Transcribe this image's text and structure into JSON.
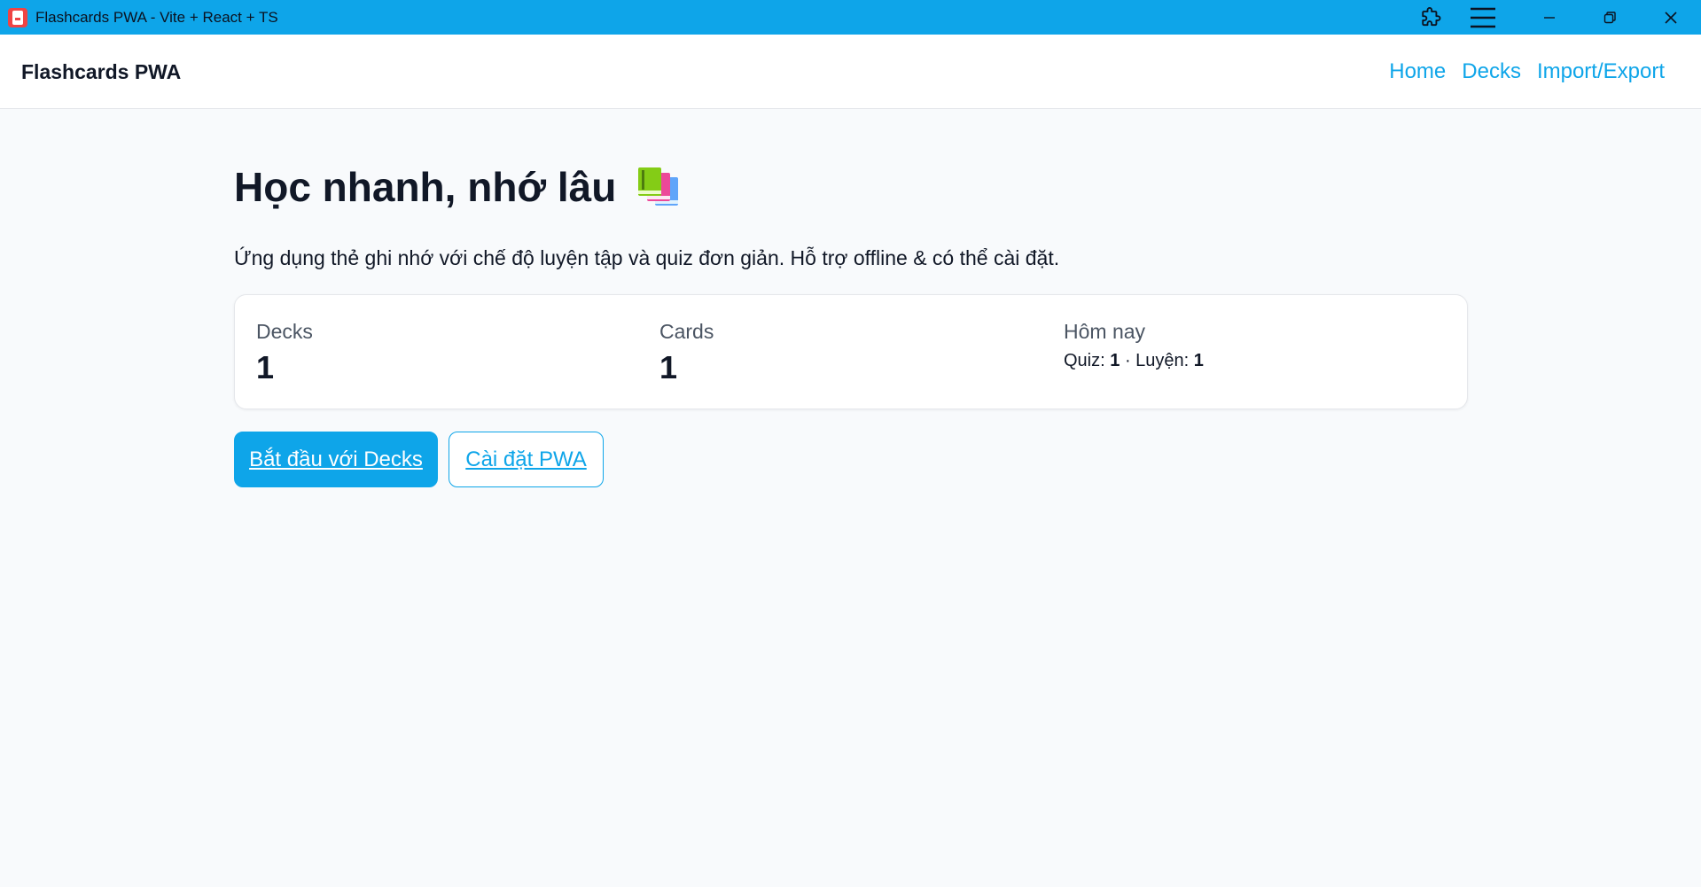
{
  "window": {
    "title": "Flashcards PWA - Vite + React + TS",
    "app_icon": "flashcards-app-icon",
    "controls": [
      "extensions-icon",
      "menu-icon",
      "minimize-icon",
      "restore-icon",
      "close-icon"
    ],
    "titlebar_color": "#0ea5e9"
  },
  "header": {
    "brand": "Flashcards PWA",
    "nav": [
      {
        "label": "Home"
      },
      {
        "label": "Decks"
      },
      {
        "label": "Import/Export"
      }
    ],
    "accent_color": "#0ea5e9"
  },
  "hero": {
    "title": "Học nhanh, nhớ lâu",
    "title_icon": "books-icon",
    "subtitle": "Ứng dụng thẻ ghi nhớ với chế độ luyện tập và quiz đơn giản. Hỗ trợ offline & có thể cài đặt."
  },
  "stats": {
    "decks": {
      "label": "Decks",
      "value": "1"
    },
    "cards": {
      "label": "Cards",
      "value": "1"
    },
    "today": {
      "label": "Hôm nay",
      "quiz_label": "Quiz:",
      "quiz_value": "1",
      "separator": "·",
      "practice_label": "Luyện:",
      "practice_value": "1"
    }
  },
  "actions": {
    "primary_label": "Bắt đầu với Decks",
    "secondary_label": "Cài đặt PWA"
  }
}
